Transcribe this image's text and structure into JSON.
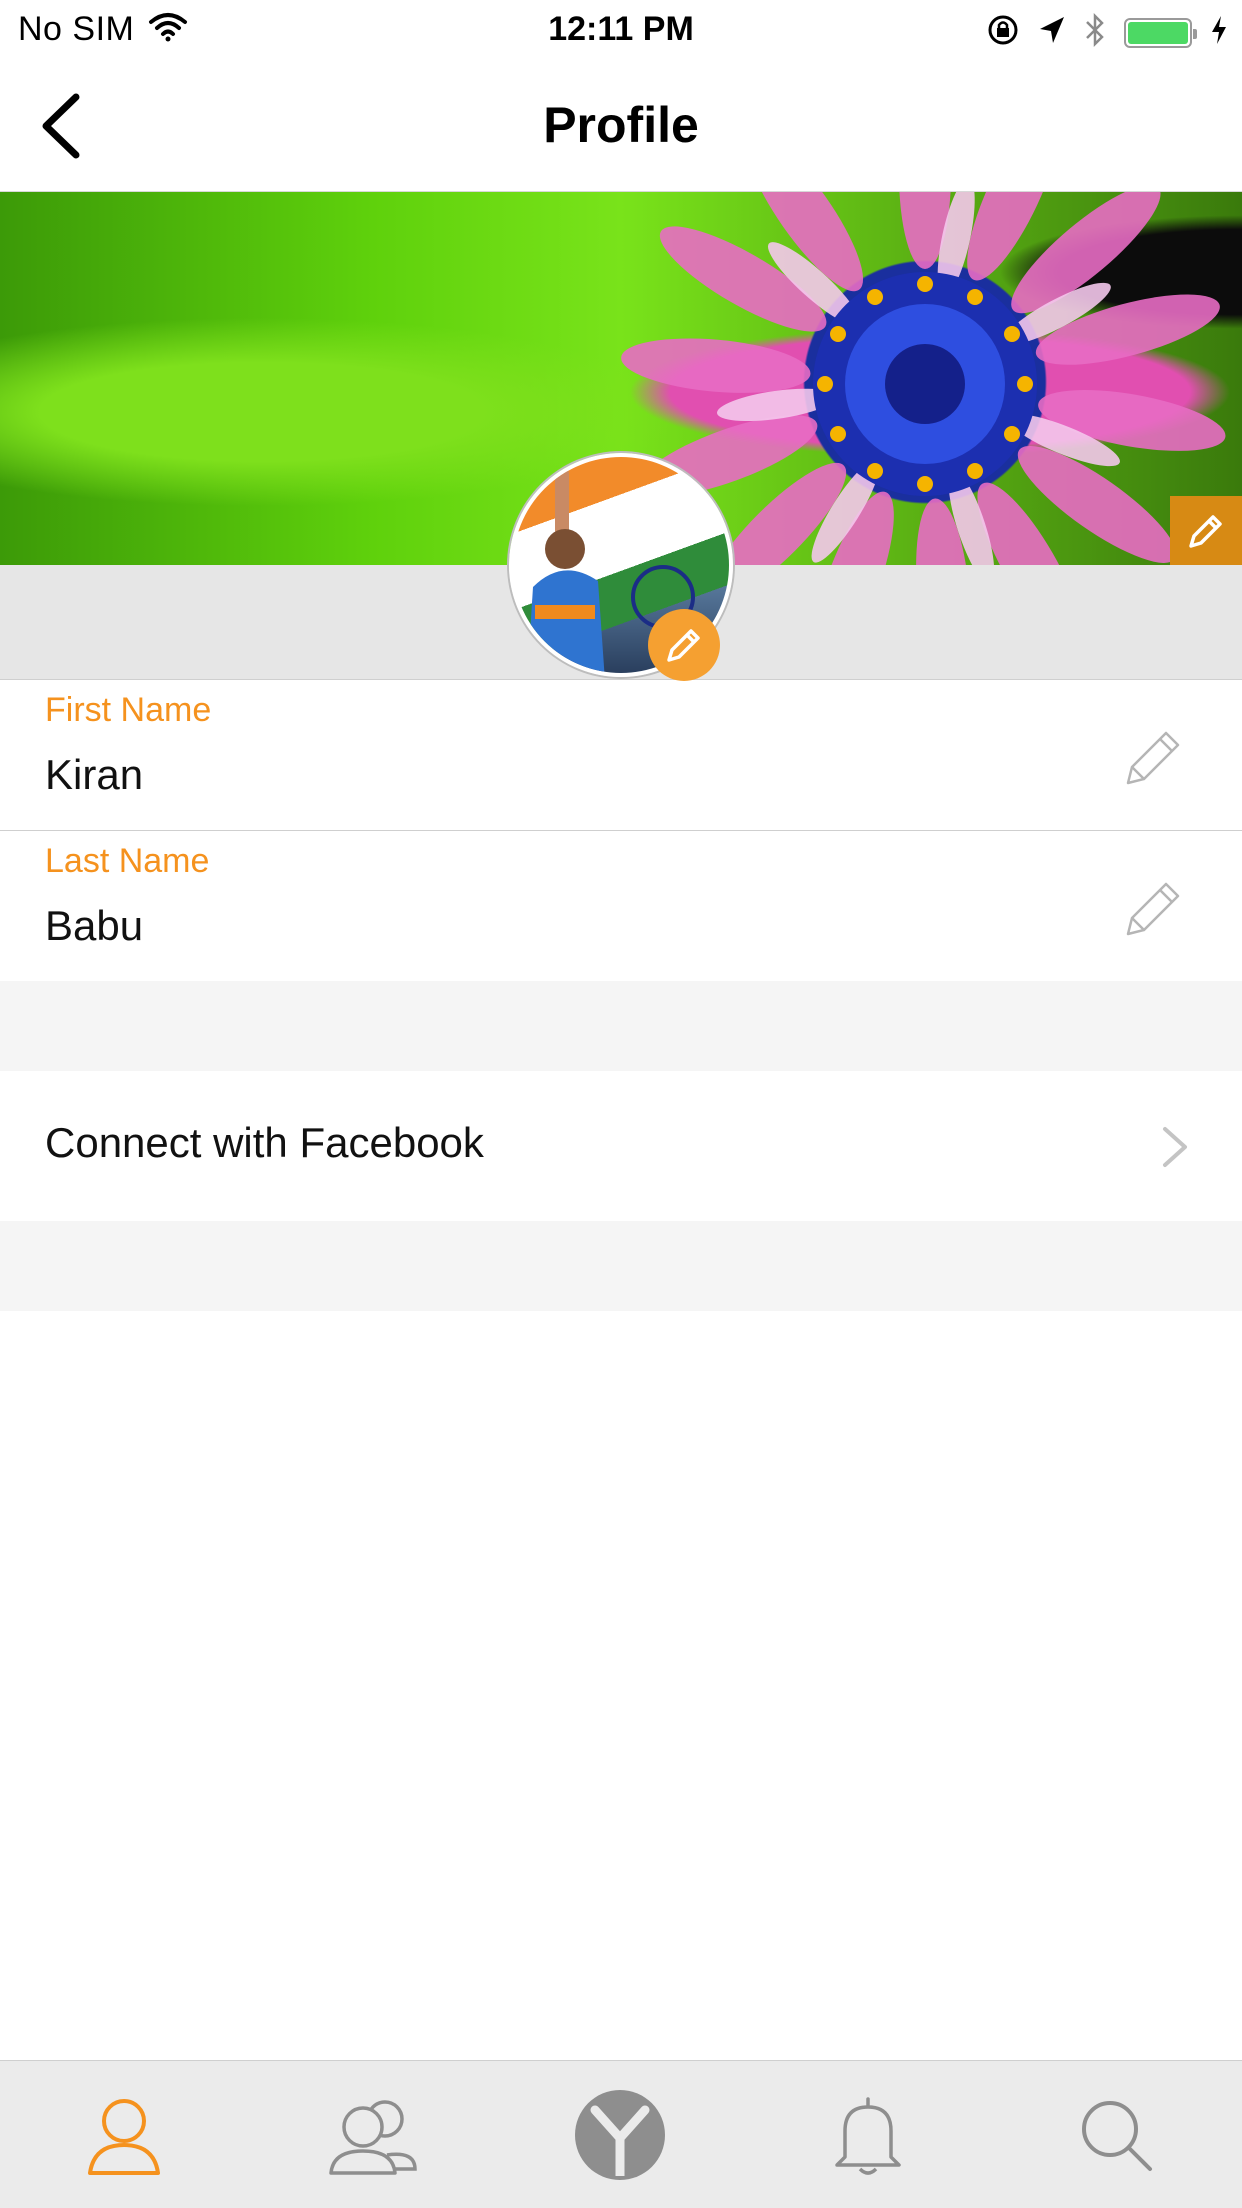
{
  "status_bar": {
    "carrier": "No SIM",
    "time": "12:11 PM",
    "battery_color": "#4cd964"
  },
  "nav": {
    "title": "Profile",
    "back_icon": "chevron-left-icon"
  },
  "cover": {
    "edit_icon": "pencil-icon",
    "edit_color": "#d78a14"
  },
  "avatar": {
    "edit_icon": "pencil-icon",
    "edit_color": "#f5a031"
  },
  "form": {
    "first_name": {
      "label": "First Name",
      "value": "Kiran"
    },
    "last_name": {
      "label": "Last Name",
      "value": "Babu"
    },
    "label_color": "#f5921e"
  },
  "facebook": {
    "label": "Connect with Facebook"
  },
  "tab_bar": {
    "active_color": "#f5921e",
    "inactive_color": "#8e8e8e",
    "tabs": [
      {
        "icon": "profile-icon",
        "active": true
      },
      {
        "icon": "contacts-icon",
        "active": false
      },
      {
        "icon": "app-logo-icon",
        "active": false
      },
      {
        "icon": "bell-icon",
        "active": false
      },
      {
        "icon": "search-icon",
        "active": false
      }
    ]
  }
}
